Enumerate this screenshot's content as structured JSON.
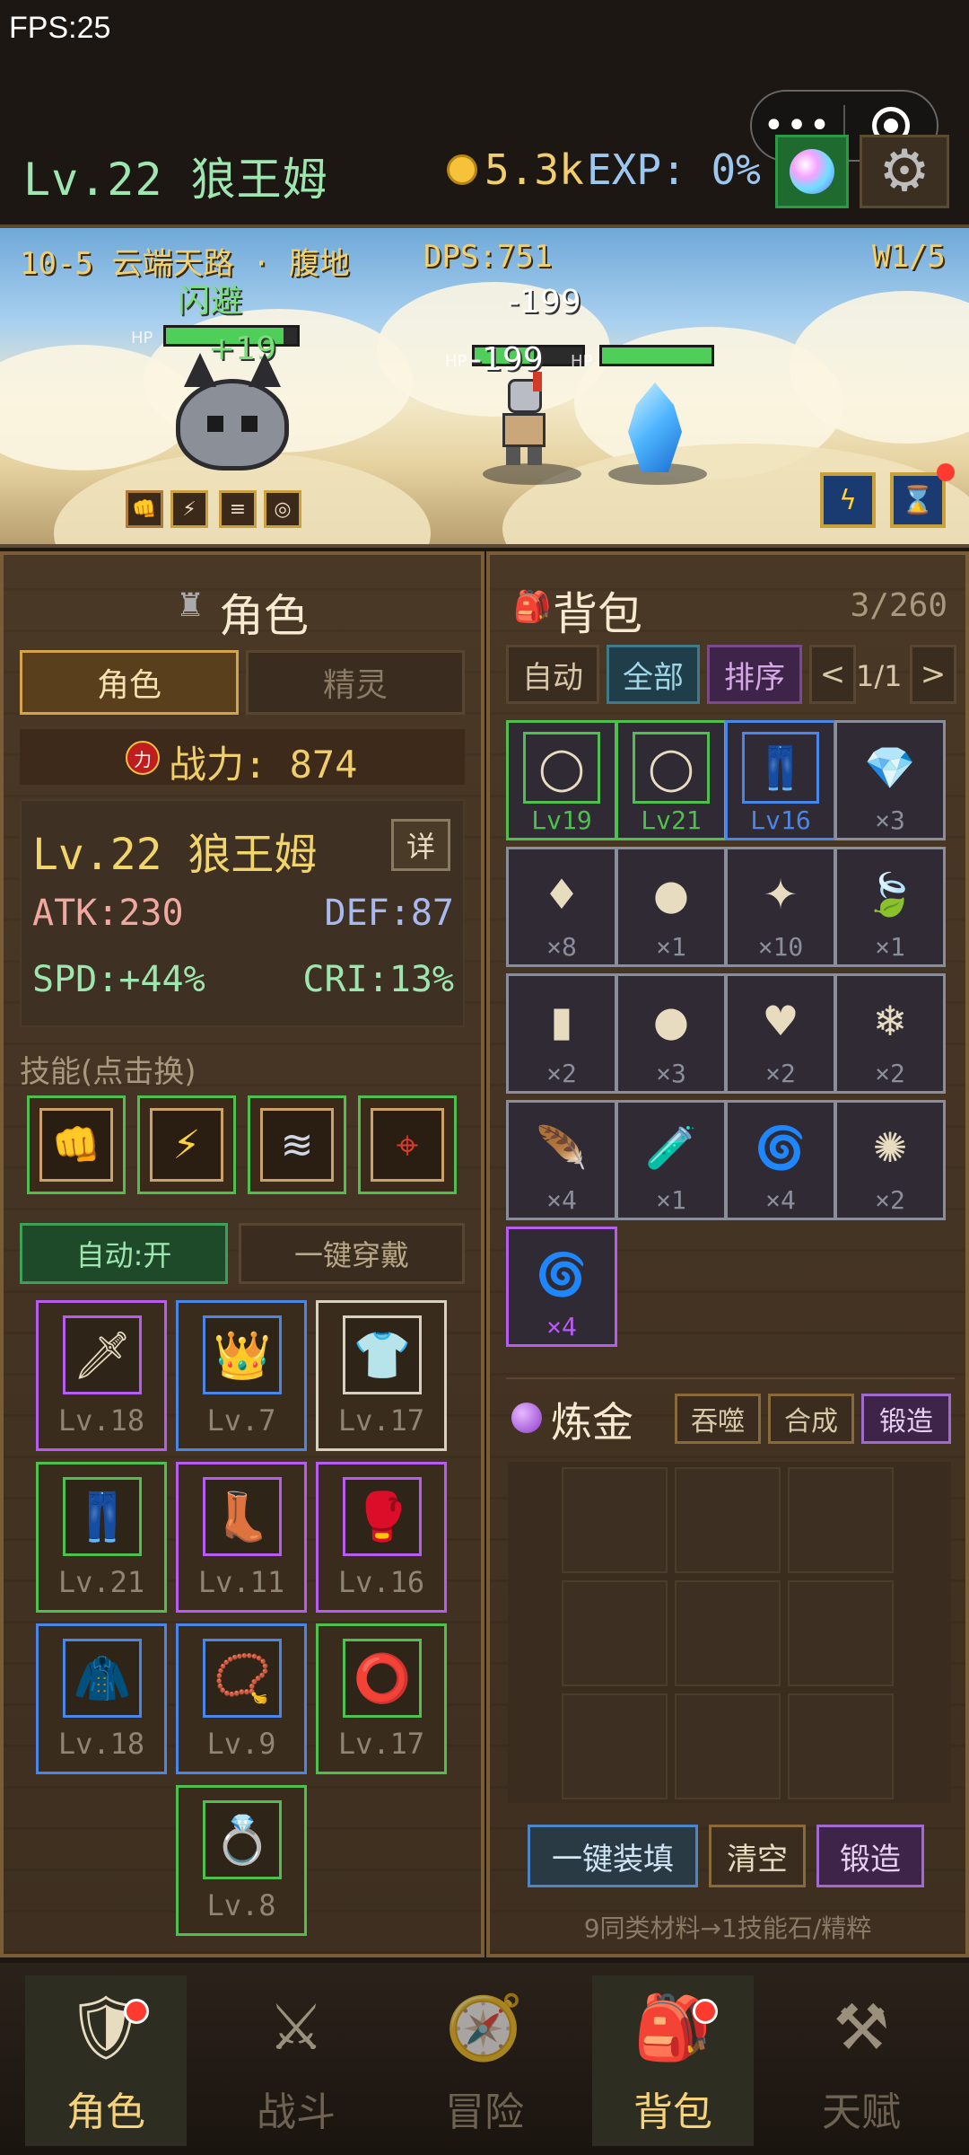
{
  "fps": "FPS:25",
  "hud": {
    "level_name": "Lv.22 狼王姆",
    "gold": "5.3k",
    "exp": "EXP: 0%"
  },
  "battle": {
    "stage": "10-5 云端天路 · 腹地",
    "dps": "DPS:751",
    "wave": "W1/5",
    "float_dodge": "闪避",
    "float_heal": "+19",
    "float_dmg1": "-199",
    "float_dmg2": "-199",
    "hp_label": "HP",
    "player_hp_fraction": 0.9,
    "enemy1_hp_fraction": 0.55,
    "enemy2_hp_fraction": 1.0
  },
  "character": {
    "title": "角色",
    "tab_character": "角色",
    "tab_spirit": "精灵",
    "power_icon": "力",
    "power": "战力: 874",
    "name": "Lv.22 狼王姆",
    "detail": "详",
    "atk": "ATK:230",
    "def": "DEF:87",
    "spd": "SPD:+44%",
    "cri": "CRI:13%",
    "skills_label": "技能(点击换)",
    "auto": "自动:开",
    "equip_all": "一键穿戴",
    "skills": [
      {
        "icon": "fist-icon"
      },
      {
        "icon": "lightning-icon"
      },
      {
        "icon": "dash-icon"
      },
      {
        "icon": "target-icon"
      }
    ],
    "equipment": [
      {
        "icon": "sword-icon",
        "glyph": "🗡",
        "level": "Lv.18",
        "color": "#b65cf0"
      },
      {
        "icon": "crown-icon",
        "glyph": "👑",
        "level": "Lv.7",
        "color": "#4a86e8"
      },
      {
        "icon": "shirt-icon",
        "glyph": "👕",
        "level": "Lv.17",
        "color": "#d8d0c0"
      },
      {
        "icon": "pants-icon",
        "glyph": "👖",
        "level": "Lv.21",
        "color": "#4fbf4f"
      },
      {
        "icon": "boots-icon",
        "glyph": "👢",
        "level": "Lv.11",
        "color": "#b65cf0"
      },
      {
        "icon": "glove-icon",
        "glyph": "🥊",
        "level": "Lv.16",
        "color": "#b65cf0"
      },
      {
        "icon": "cloak-icon",
        "glyph": "🧥",
        "level": "Lv.18",
        "color": "#4a86e8"
      },
      {
        "icon": "necklace-icon",
        "glyph": "📿",
        "level": "Lv.9",
        "color": "#4a86e8"
      },
      {
        "icon": "bracelet-icon",
        "glyph": "⭕",
        "level": "Lv.17",
        "color": "#4fbf4f"
      },
      {
        "icon": "ring-icon",
        "glyph": "💍",
        "level": "Lv.8",
        "color": "#4fbf4f"
      }
    ]
  },
  "bag": {
    "title": "背包",
    "capacity": "3/260",
    "auto": "自动",
    "all": "全部",
    "sort": "排序",
    "prev": "<",
    "page": "1/1",
    "next": ">",
    "items": [
      {
        "icon": "ring-icon",
        "glyph": "◯",
        "label": "Lv19",
        "color": "#4fbf4f",
        "framed": true
      },
      {
        "icon": "ring-icon",
        "glyph": "◯",
        "label": "Lv21",
        "color": "#4fbf4f",
        "framed": true
      },
      {
        "icon": "pants-icon",
        "glyph": "👖",
        "label": "Lv16",
        "color": "#4a86e8",
        "framed": true
      },
      {
        "icon": "blue-crystal-icon",
        "glyph": "💎",
        "label": "×3",
        "color": "#8a8e9a",
        "framed": false
      },
      {
        "icon": "purple-gem-icon",
        "glyph": "♦",
        "label": "×8",
        "color": "#8a8e9a",
        "framed": false
      },
      {
        "icon": "purple-orb-icon",
        "glyph": "●",
        "label": "×1",
        "color": "#8a8e9a",
        "framed": false
      },
      {
        "icon": "purple-crystal-icon",
        "glyph": "✦",
        "label": "×10",
        "color": "#8a8e9a",
        "framed": false
      },
      {
        "icon": "seed-icon",
        "glyph": "🍃",
        "label": "×1",
        "color": "#8a8e9a",
        "framed": false
      },
      {
        "icon": "rune-icon",
        "glyph": "▮",
        "label": "×2",
        "color": "#8a8e9a",
        "framed": false
      },
      {
        "icon": "dark-orb-icon",
        "glyph": "●",
        "label": "×3",
        "color": "#8a8e9a",
        "framed": false
      },
      {
        "icon": "heart-icon",
        "glyph": "♥",
        "label": "×2",
        "color": "#8a8e9a",
        "framed": false
      },
      {
        "icon": "ice-shard-icon",
        "glyph": "❄",
        "label": "×2",
        "color": "#8a8e9a",
        "framed": false
      },
      {
        "icon": "feather-icon",
        "glyph": "🪶",
        "label": "×4",
        "color": "#8a8e9a",
        "framed": false
      },
      {
        "icon": "potion-icon",
        "glyph": "🧪",
        "label": "×1",
        "color": "#8a8e9a",
        "framed": false
      },
      {
        "icon": "red-swirl-icon",
        "glyph": "🌀",
        "label": "×4",
        "color": "#8a8e9a",
        "framed": false
      },
      {
        "icon": "dust-icon",
        "glyph": "✺",
        "label": "×2",
        "color": "#8a8e9a",
        "framed": false
      },
      {
        "icon": "red-swirl-icon",
        "glyph": "🌀",
        "label": "×4",
        "color": "#b65cf0",
        "framed": false
      }
    ]
  },
  "alchemy": {
    "title": "炼金",
    "devour": "吞噬",
    "combine": "合成",
    "forge_tab": "锻造",
    "fill": "一键装填",
    "clear": "清空",
    "forge": "锻造",
    "hint": "9同类材料→1技能石/精粹"
  },
  "nav": [
    {
      "label": "角色",
      "icon": "knight-icon"
    },
    {
      "label": "战斗",
      "icon": "sword-shield-icon"
    },
    {
      "label": "冒险",
      "icon": "compass-icon"
    },
    {
      "label": "背包",
      "icon": "backpack-icon"
    },
    {
      "label": "天赋",
      "icon": "anvil-icon"
    }
  ]
}
